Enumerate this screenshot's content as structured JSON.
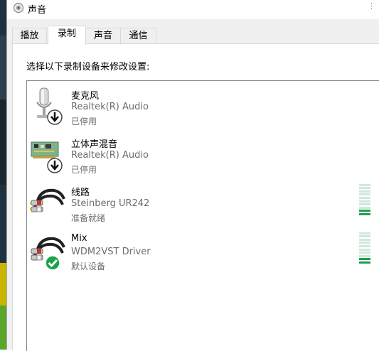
{
  "window": {
    "title": "声音"
  },
  "tabs": [
    {
      "label": "播放"
    },
    {
      "label": "录制"
    },
    {
      "label": "声音"
    },
    {
      "label": "通信"
    }
  ],
  "active_tab": "录制",
  "recording": {
    "instruction": "选择以下录制设备来修改设置:",
    "devices": [
      {
        "name": "麦克风",
        "driver": "Realtek(R) Audio",
        "status": "已停用",
        "icon": "microphone-icon",
        "badge": "disabled-down-arrow-icon"
      },
      {
        "name": "立体声混音",
        "driver": "Realtek(R) Audio",
        "status": "已停用",
        "icon": "sound-card-icon",
        "badge": "disabled-down-arrow-icon"
      },
      {
        "name": "线路",
        "driver": "Steinberg UR242",
        "status": "准备就绪",
        "icon": "rca-cable-icon",
        "level_fraction": 0.2
      },
      {
        "name": "Mix",
        "driver": "WDM2VST Driver",
        "status": "默认设备",
        "icon": "rca-cable-icon",
        "badge": "default-check-icon",
        "level_fraction": 0.2
      }
    ]
  },
  "colors": {
    "level_on": "#1f9d4d",
    "level_off": "#cfe9dc",
    "default_badge": "#1aa34a"
  }
}
